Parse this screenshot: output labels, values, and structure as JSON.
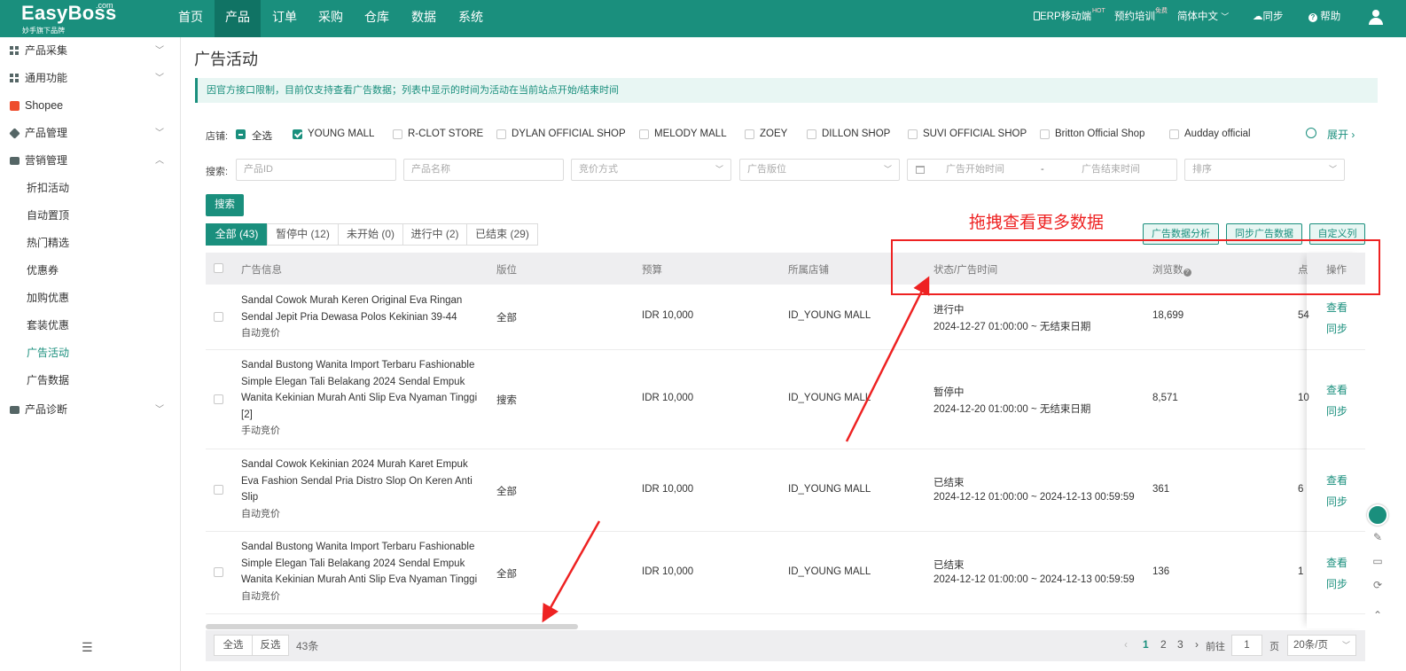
{
  "brand": {
    "name": "EasyBoss",
    "com": ".com",
    "tagline": "妙手旗下品牌"
  },
  "nav": [
    {
      "label": "首页"
    },
    {
      "label": "产品"
    },
    {
      "label": "订单"
    },
    {
      "label": "采购"
    },
    {
      "label": "仓库"
    },
    {
      "label": "数据"
    },
    {
      "label": "系统"
    }
  ],
  "top_right": {
    "erp": "ERP移动端",
    "erp_badge": "HOT",
    "train": "预约培训",
    "train_badge": "免费",
    "lang": "简体中文",
    "sync": "同步",
    "help": "帮助"
  },
  "sidebar": {
    "items": [
      {
        "label": "产品采集"
      },
      {
        "label": "通用功能"
      },
      {
        "label": "Shopee"
      },
      {
        "label": "产品管理"
      },
      {
        "label": "营销管理"
      },
      {
        "label": "折扣活动"
      },
      {
        "label": "自动置顶"
      },
      {
        "label": "热门精选"
      },
      {
        "label": "优惠券"
      },
      {
        "label": "加购优惠"
      },
      {
        "label": "套装优惠"
      },
      {
        "label": "广告活动"
      },
      {
        "label": "广告数据"
      },
      {
        "label": "产品诊断"
      }
    ]
  },
  "page": {
    "title": "广告活动",
    "notice": "因官方接口限制，目前仅支持查看广告数据；列表中显示的时间为活动在当前站点开始/结束时间"
  },
  "filters": {
    "store_label": "店铺:",
    "select_all": "全选",
    "shops": [
      {
        "label": "YOUNG MALL",
        "checked": true
      },
      {
        "label": "R-CLOT STORE",
        "checked": false
      },
      {
        "label": "DYLAN OFFICIAL SHOP",
        "checked": false
      },
      {
        "label": "MELODY MALL",
        "checked": false
      },
      {
        "label": "ZOEY",
        "checked": false
      },
      {
        "label": "DILLON SHOP",
        "checked": false
      },
      {
        "label": "SUVI OFFICIAL SHOP",
        "checked": false
      },
      {
        "label": "Britton Official Shop",
        "checked": false
      },
      {
        "label": "Audday official",
        "checked": false
      }
    ],
    "expand": "展开",
    "search_label": "搜索:",
    "product_id_placeholder": "产品ID",
    "product_name_placeholder": "产品名称",
    "bid_placeholder": "竞价方式",
    "slot_placeholder": "广告版位",
    "start_placeholder": "广告开始时间",
    "range_sep": "-",
    "end_placeholder": "广告结束时间",
    "sort_placeholder": "排序",
    "search_button": "搜索"
  },
  "tabs": [
    {
      "label": "全部 (43)"
    },
    {
      "label": "暂停中 (12)"
    },
    {
      "label": "未开始 (0)"
    },
    {
      "label": "进行中 (2)"
    },
    {
      "label": "已结束 (29)"
    }
  ],
  "actions": {
    "analysis": "广告数据分析",
    "sync_data": "同步广告数据",
    "custom_cols": "自定义列"
  },
  "annotation": "拖拽查看更多数据",
  "table": {
    "headers": [
      "广告信息",
      "版位",
      "预算",
      "所属店铺",
      "状态/广告时间",
      "浏览数",
      "点",
      "操作"
    ],
    "rows": [
      {
        "title": "Sandal Cowok Murah Keren Original Eva Ringan Sendal Jepit Pria Dewasa Polos Kekinian 39-44",
        "bid": "自动竞价",
        "slot": "全部",
        "budget": "IDR 10,000",
        "shop": "ID_YOUNG MALL",
        "status": "进行中",
        "time": "2024-12-27 01:00:00 ~ 无结束日期",
        "views": "18,699",
        "clicks": "54",
        "view": "查看",
        "sync": "同步"
      },
      {
        "title": "Sandal Bustong Wanita Import Terbaru Fashionable Simple Elegan Tali Belakang 2024 Sendal Empuk Wanita Kekinian Murah Anti Slip Eva Nyaman Tinggi [2]",
        "bid": "手动竞价",
        "slot": "搜索",
        "budget": "IDR 10,000",
        "shop": "ID_YOUNG MALL",
        "status": "暂停中",
        "time": "2024-12-20 01:00:00 ~ 无结束日期",
        "views": "8,571",
        "clicks": "10",
        "view": "查看",
        "sync": "同步"
      },
      {
        "title": "Sandal Cowok Kekinian 2024 Murah Karet Empuk Eva Fashion Sendal Pria Distro Slop On Keren Anti Slip",
        "bid": "自动竞价",
        "slot": "全部",
        "budget": "IDR 10,000",
        "shop": "ID_YOUNG MALL",
        "status": "已结束",
        "time": "2024-12-12 01:00:00 ~ 2024-12-13 00:59:59",
        "views": "361",
        "clicks": "6",
        "view": "查看",
        "sync": "同步"
      },
      {
        "title": "Sandal Bustong Wanita Import Terbaru Fashionable Simple Elegan Tali Belakang 2024 Sendal Empuk Wanita Kekinian Murah Anti Slip Eva Nyaman Tinggi",
        "bid": "自动竞价",
        "slot": "全部",
        "budget": "IDR 10,000",
        "shop": "ID_YOUNG MALL",
        "status": "已结束",
        "time": "2024-12-12 01:00:00 ~ 2024-12-13 00:59:59",
        "views": "136",
        "clicks": "1",
        "view": "查看",
        "sync": "同步"
      }
    ]
  },
  "footer": {
    "select_all": "全选",
    "invert": "反选",
    "count": "43条",
    "pages": [
      "1",
      "2",
      "3"
    ],
    "goto": "前往",
    "page_value": "1",
    "page_unit": "页",
    "page_size": "20条/页"
  },
  "colors": {
    "primary": "#1a8f7d",
    "annotation": "#ee2222"
  }
}
